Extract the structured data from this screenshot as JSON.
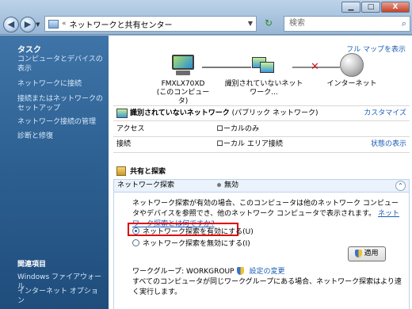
{
  "window": {
    "minimize_glyph": "▁",
    "maximize_glyph": "□",
    "close_glyph": "X"
  },
  "nav": {
    "back_glyph": "◀",
    "forward_glyph": "▶",
    "address_separator": "«",
    "address_text": "ネットワークと共有センター",
    "search_placeholder": "検索"
  },
  "sidebar": {
    "tasks_heading": "タスク",
    "tasks": [
      "コンピュータとデバイスの表示",
      "ネットワークに接続",
      "接続またはネットワークのセットアップ",
      "ネットワーク接続の管理",
      "診断と修復"
    ],
    "related_heading": "関連項目",
    "related": [
      "Windows ファイアウォール",
      "インターネット オプション"
    ]
  },
  "map": {
    "full_map_link": "フル マップを表示",
    "computer_label_1": "FMXLX70XD",
    "computer_label_2": "(このコンピュータ)",
    "network_label": "識別されていないネットワーク...",
    "internet_label": "インターネット"
  },
  "network": {
    "name": "識別されていないネットワーク",
    "type": "(パブリック ネットワーク)",
    "customize_link": "カスタマイズ",
    "access_label": "アクセス",
    "access_value": "ローカルのみ",
    "connection_label": "接続",
    "connection_value": "ローカル エリア接続",
    "status_link": "状態の表示"
  },
  "sharing": {
    "section_title": "共有と探索",
    "discovery_label": "ネットワーク探索",
    "discovery_value": "無効",
    "description": "ネットワーク探索が有効の場合、このコンピュータは他のネットワーク コンピュータやデバイスを参照でき、他のネットワーク コンピュータで表示されます。",
    "description_link": "ネットワーク探索とは何ですか?",
    "option_on": "ネットワーク探索を有効にする(U)",
    "option_off": "ネットワーク探索を無効にする(I)",
    "apply_label": "適用",
    "workgroup_label": "ワークグループ: WORKGROUP",
    "change_settings_link": "設定の変更",
    "footer_text": "すべてのコンピュータが同じワークグループにある場合、ネットワーク探索はより速く実行します。"
  }
}
